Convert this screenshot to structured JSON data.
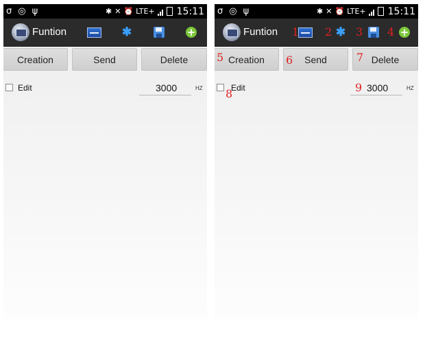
{
  "status_bar": {
    "network": "LTE+",
    "time": "15:11",
    "icons": [
      "g-logo-icon",
      "circle-icon",
      "usb-icon",
      "bluetooth-icon",
      "mute-icon",
      "alarm-icon",
      "signal-icon",
      "battery-icon"
    ]
  },
  "app": {
    "title": "Funtion",
    "actions": [
      {
        "name": "waveform-icon"
      },
      {
        "name": "bluetooth-icon"
      },
      {
        "name": "save-icon"
      },
      {
        "name": "add-icon"
      }
    ]
  },
  "buttons": {
    "creation": "Creation",
    "send": "Send",
    "delete": "Delete"
  },
  "edit": {
    "label": "Edit",
    "checked": false
  },
  "frequency": {
    "value": "3000",
    "unit": "HZ"
  },
  "annotations": [
    "1",
    "2",
    "3",
    "4",
    "5",
    "6",
    "7",
    "8",
    "9"
  ],
  "colors": {
    "action_bar": "#2b2b2b",
    "annotation": "#e02020",
    "add_green": "#7cc63a"
  }
}
